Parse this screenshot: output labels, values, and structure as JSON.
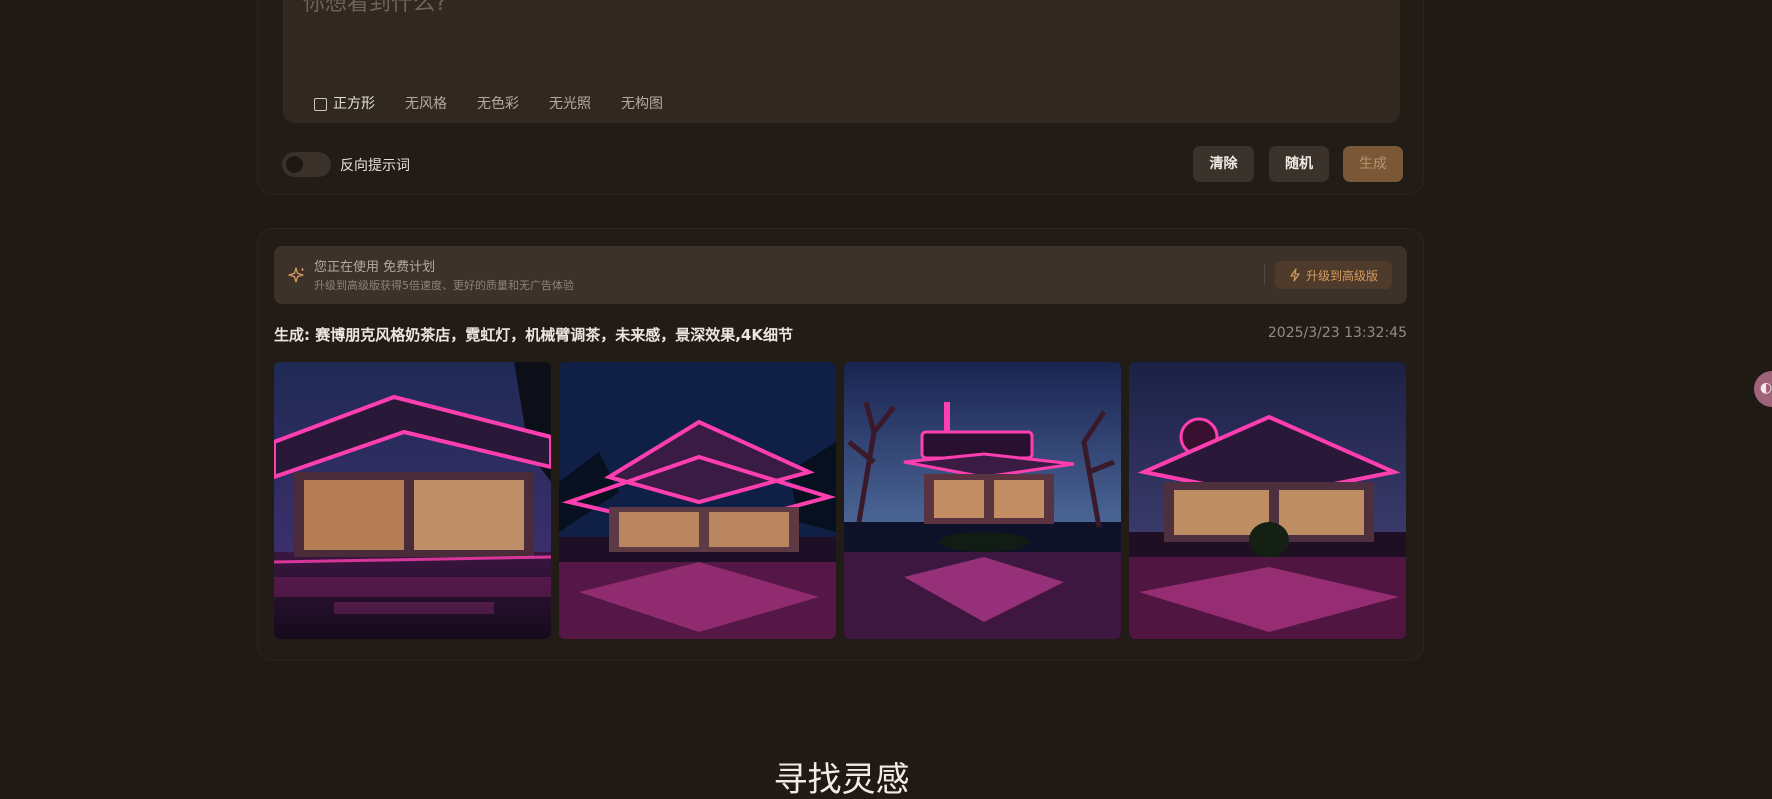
{
  "prompt": {
    "placeholder": "你想看到什么?",
    "chips": [
      {
        "label": "正方形"
      },
      {
        "label": "无风格"
      },
      {
        "label": "无色彩"
      },
      {
        "label": "无光照"
      },
      {
        "label": "无构图"
      }
    ],
    "negative_toggle_label": "反向提示词",
    "negative_toggle_on": false,
    "buttons": {
      "clear": "清除",
      "random": "随机",
      "generate": "生成"
    }
  },
  "plan": {
    "title": "您正在使用 免费计划",
    "subtitle": "升级到高级版获得5倍速度、更好的质量和无广告体验",
    "upgrade_label": "升级到高级版"
  },
  "generation": {
    "title": "生成: 赛博朋克风格奶茶店，霓虹灯，机械臂调茶，未来感，景深效果,4K细节",
    "timestamp": "2025/3/23 13:32:45",
    "images": [
      {
        "alt": "neon pink cafe"
      },
      {
        "alt": "neon pink cafe"
      },
      {
        "alt": "neon pink cafe"
      },
      {
        "alt": "neon pink cafe"
      }
    ]
  },
  "inspiration_heading": "寻找灵感",
  "colors": {
    "background": "#201a15",
    "accent": "#d69a5e",
    "neon": "#ff2fa6"
  }
}
